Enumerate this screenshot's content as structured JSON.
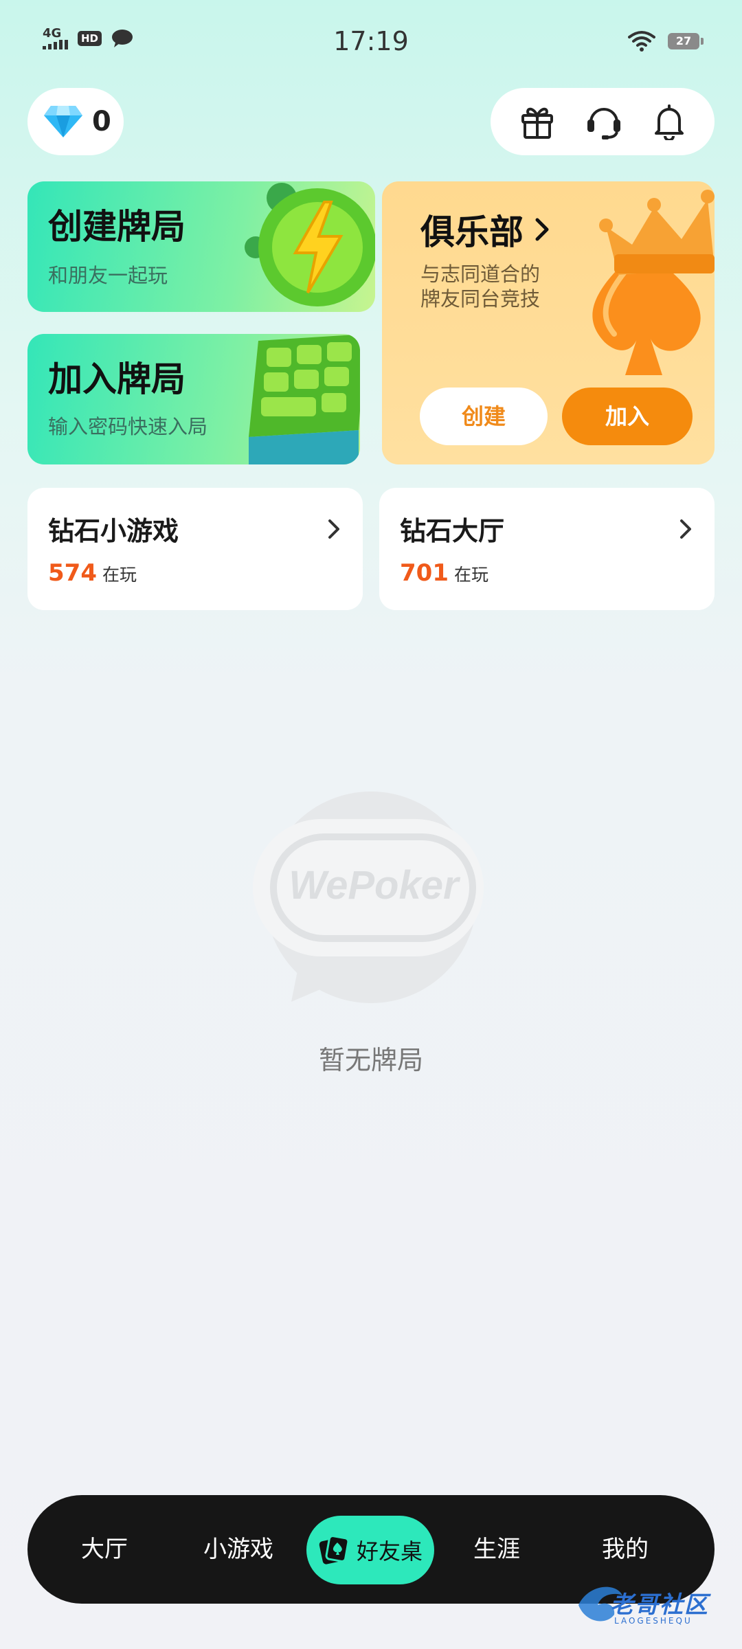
{
  "status_bar": {
    "network": "4G",
    "hd": "HD",
    "time": "17:19",
    "battery": "27"
  },
  "header": {
    "gem_count": "0",
    "icons": [
      "gift-icon",
      "support-headset-icon",
      "bell-icon"
    ]
  },
  "create_table": {
    "title": "创建牌局",
    "subtitle": "和朋友一起玩"
  },
  "join_table": {
    "title": "加入牌局",
    "subtitle": "输入密码快速入局"
  },
  "club": {
    "title": "俱乐部",
    "subtitle_line1": "与志同道合的",
    "subtitle_line2": "牌友同台竞技",
    "create_label": "创建",
    "join_label": "加入"
  },
  "diamond_minigames": {
    "title": "钻石小游戏",
    "count": "574",
    "count_label": "在玩"
  },
  "diamond_hall": {
    "title": "钻石大厅",
    "count": "701",
    "count_label": "在玩"
  },
  "empty_state": {
    "logo_text": "WePoker",
    "message": "暂无牌局"
  },
  "bottom_nav": {
    "items": [
      "大厅",
      "小游戏",
      "好友桌",
      "生涯",
      "我的"
    ],
    "active_index": 2
  },
  "watermark": {
    "text": "老哥社区",
    "subtext": "LAOGESHEQU"
  },
  "colors": {
    "accent_green": "#2de8bb",
    "accent_orange": "#f58b0d",
    "count_red": "#f05a1a"
  }
}
